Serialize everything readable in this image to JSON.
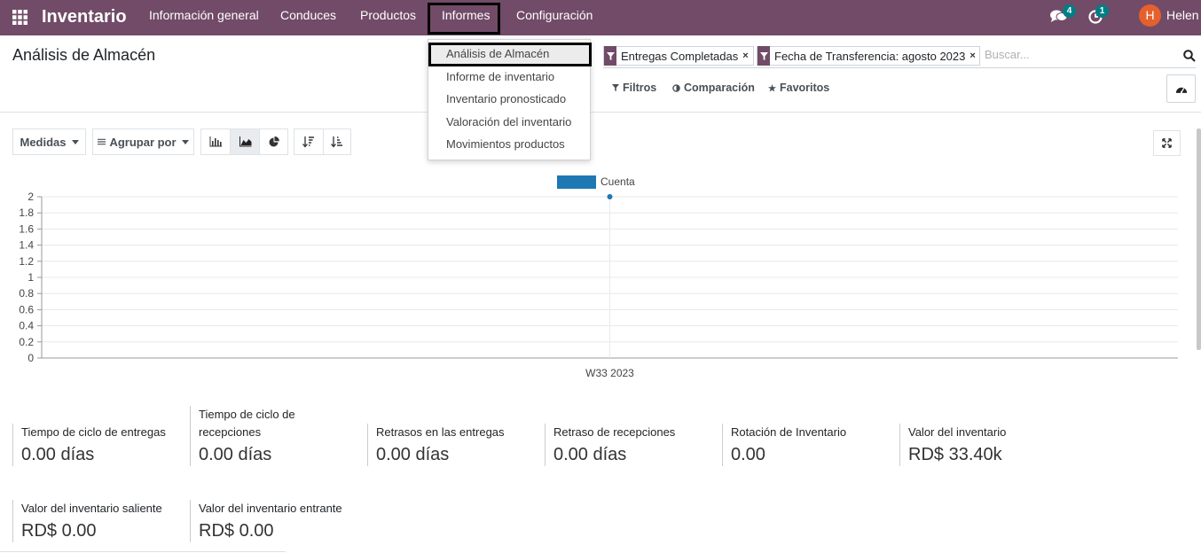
{
  "topbar": {
    "app_name": "Inventario",
    "menu": [
      "Información general",
      "Conduces",
      "Productos",
      "Informes",
      "Configuración"
    ],
    "messages_count": "4",
    "activities_count": "1",
    "user_initial": "H",
    "user_name": "Helen",
    "color": "#714B67"
  },
  "control_panel": {
    "title": "Análisis de Almacén",
    "facets": [
      "Entregas Completadas",
      "Fecha de Transferencia: agosto 2023"
    ],
    "search_placeholder": "Buscar...",
    "filters": "Filtros",
    "comparison": "Comparación",
    "favorites": "Favoritos"
  },
  "reports_dropdown": {
    "items": [
      "Análisis de Almacén",
      "Informe de inventario",
      "Inventario pronosticado",
      "Valoración del inventario",
      "Movimientos productos"
    ],
    "active": "Análisis de Almacén"
  },
  "toolbar": {
    "measures": "Medidas",
    "group_by": "Agrupar por"
  },
  "chart_data": {
    "type": "area",
    "legend": "top-center",
    "series": [
      {
        "name": "Cuenta",
        "values": [
          2
        ]
      }
    ],
    "categories": [
      "W33 2023"
    ],
    "ylim": [
      0,
      2
    ],
    "yticks": [
      "0",
      "0.2",
      "0.4",
      "0.6",
      "0.8",
      "1",
      "1.2",
      "1.4",
      "1.6",
      "1.8",
      "2"
    ],
    "grid": true,
    "color": "#1f77b4"
  },
  "kpis": [
    {
      "label": "Tiempo de ciclo de entregas",
      "value": "0.00 días"
    },
    {
      "label": "Tiempo de ciclo de recepciones",
      "value": "0.00 días"
    },
    {
      "label": "Retrasos en las entregas",
      "value": "0.00 días"
    },
    {
      "label": "Retraso de recepciones",
      "value": "0.00 días"
    },
    {
      "label": "Rotación de Inventario",
      "value": "0.00"
    },
    {
      "label": "Valor del inventario",
      "value": "RD$ 33.40k"
    },
    {
      "label": "Valor del inventario saliente",
      "value": "RD$ 0.00"
    },
    {
      "label": "Valor del inventario entrante",
      "value": "RD$ 0.00"
    }
  ]
}
